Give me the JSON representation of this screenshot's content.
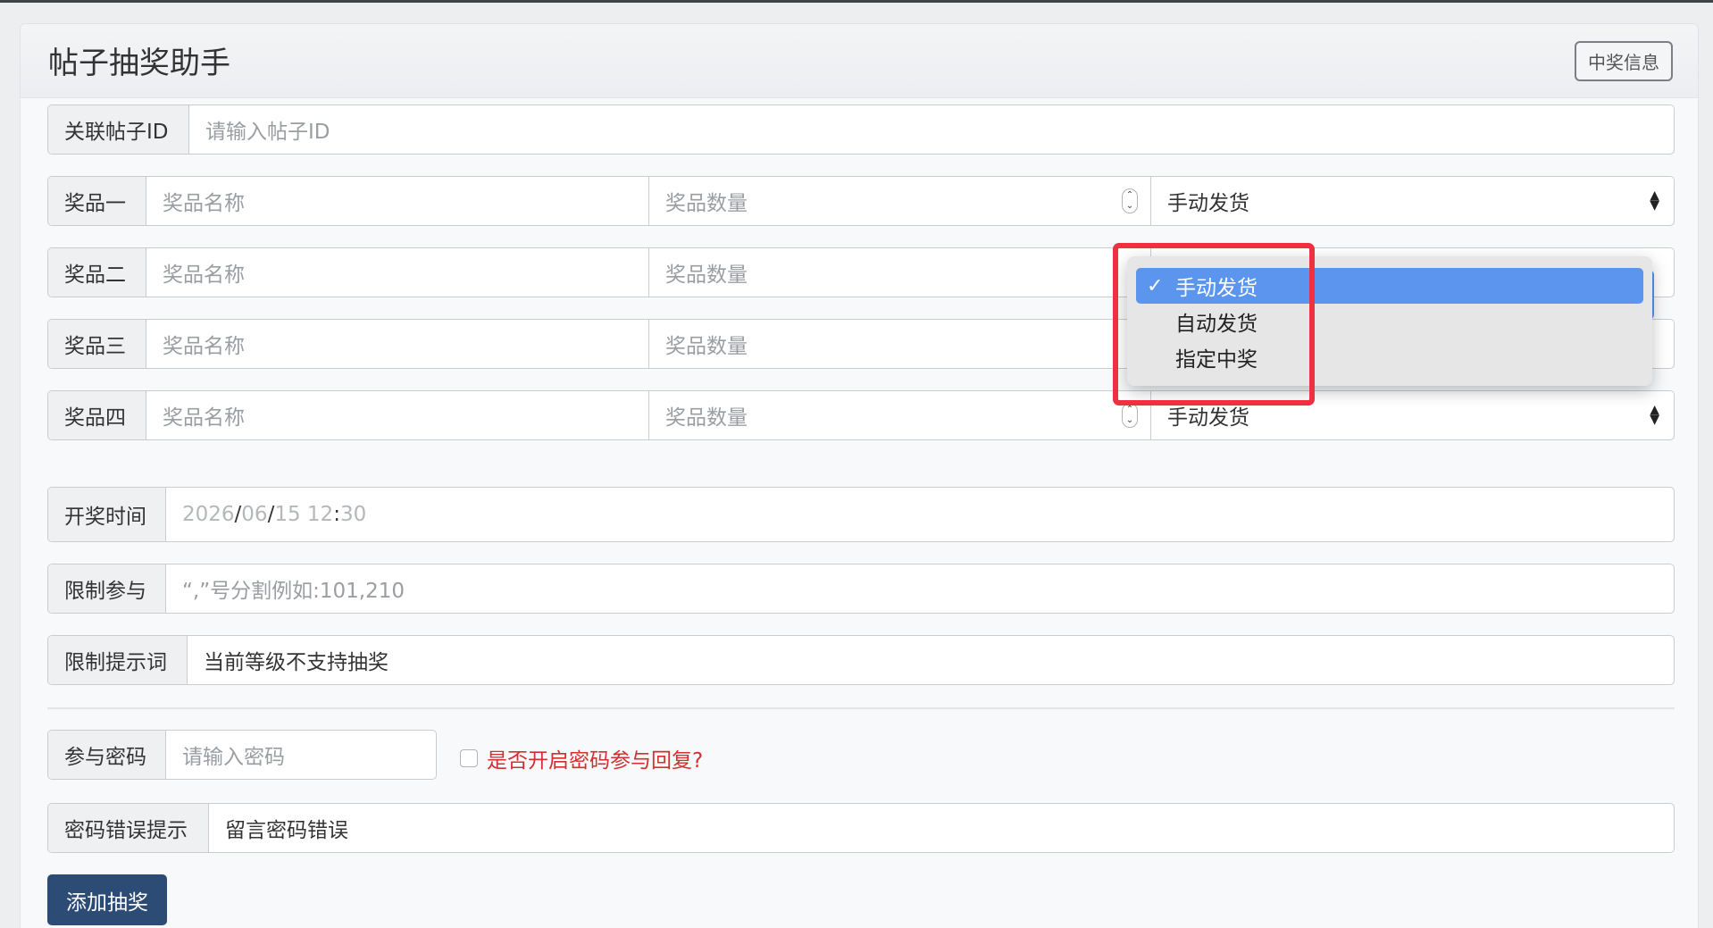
{
  "header": {
    "title": "帖子抽奖助手",
    "button_label": "中奖信息"
  },
  "post_id": {
    "label": "关联帖子ID",
    "placeholder": "请输入帖子ID"
  },
  "prizes": [
    {
      "label": "奖品一",
      "name_placeholder": "奖品名称",
      "qty_placeholder": "奖品数量",
      "delivery": "手动发货"
    },
    {
      "label": "奖品二",
      "name_placeholder": "奖品名称",
      "qty_placeholder": "奖品数量",
      "delivery": ""
    },
    {
      "label": "奖品三",
      "name_placeholder": "奖品名称",
      "qty_placeholder": "奖品数量",
      "delivery": ""
    },
    {
      "label": "奖品四",
      "name_placeholder": "奖品名称",
      "qty_placeholder": "奖品数量",
      "delivery": "手动发货"
    }
  ],
  "draw_time": {
    "label": "开奖时间",
    "year": "2026",
    "month": "06",
    "day": "15",
    "hour": "12",
    "minute": "30"
  },
  "restrict": {
    "label": "限制参与",
    "placeholder": "“,”号分割例如:101,210"
  },
  "restrict_tip": {
    "label": "限制提示词",
    "value": "当前等级不支持抽奖"
  },
  "password": {
    "label": "参与密码",
    "placeholder": "请输入密码",
    "checkbox_label": "是否开启密码参与回复?"
  },
  "password_error": {
    "label": "密码错误提示",
    "value": "留言密码错误"
  },
  "submit_label": "添加抽奖",
  "dropdown": {
    "options": [
      "手动发货",
      "自动发货",
      "指定中奖"
    ],
    "selected_index": 0
  },
  "colors": {
    "primary": "#2c4c75",
    "selected_option": "#5b95ee",
    "highlight": "#ee3040",
    "warning_text": "#d22f2f"
  }
}
